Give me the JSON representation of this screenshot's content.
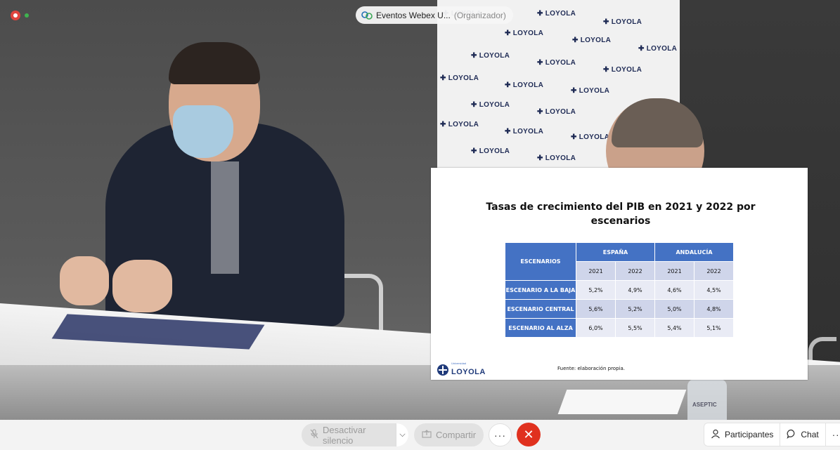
{
  "window": {
    "title": "Eventos Webex U...",
    "role": "(Organizador)"
  },
  "backdrop": {
    "logo_text": "LOYOLA"
  },
  "slide": {
    "title_line1": "Tasas de crecimiento del PIB en 2021 y 2022 por",
    "title_line2": "escenarios",
    "table": {
      "corner": "ESCENARIOS",
      "groups": [
        "ESPAÑA",
        "ANDALUCÍA"
      ],
      "years": [
        "2021",
        "2022",
        "2021",
        "2022"
      ],
      "rows": [
        {
          "label": "ESCENARIO A LA BAJA",
          "values": [
            "5,2%",
            "4,9%",
            "4,6%",
            "4,5%"
          ]
        },
        {
          "label": "ESCENARIO CENTRAL",
          "values": [
            "5,6%",
            "5,2%",
            "5,0%",
            "4,8%"
          ]
        },
        {
          "label": "ESCENARIO AL ALZA",
          "values": [
            "6,0%",
            "5,5%",
            "5,4%",
            "5,1%"
          ]
        }
      ]
    },
    "logo_small": "Universidad",
    "logo_big": "LOYOLA",
    "source": "Fuente: elaboración propia."
  },
  "scene": {
    "bottle_label": "ASEPTIC"
  },
  "controls": {
    "mute_label": "Desactivar silencio",
    "share_label": "Compartir",
    "more_label": "···",
    "participants_label": "Participantes",
    "chat_label": "Chat",
    "right_more_label": "···"
  },
  "colors": {
    "accent_blue": "#4472c4",
    "end_call_red": "#e0311e"
  }
}
